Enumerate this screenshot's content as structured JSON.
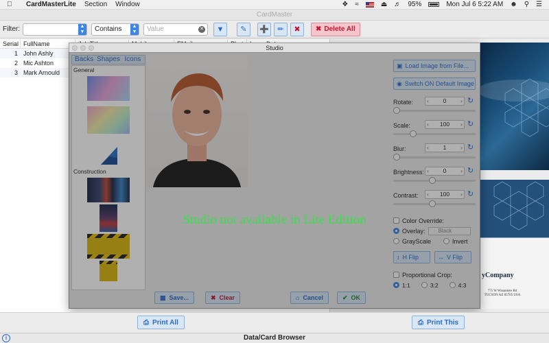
{
  "menubar": {
    "app_name": "CardMasterLite",
    "items": [
      "Section",
      "Window"
    ],
    "battery": "95%",
    "datetime": "Mon Jul 6  5:22 AM"
  },
  "main_window": {
    "title": "CardMaster"
  },
  "toolbar": {
    "filter_label": "Filter:",
    "filter_value": "",
    "operator": "Contains",
    "value_placeholder": "Value",
    "delete_all_label": "Delete All"
  },
  "table": {
    "headers": [
      "Serial",
      "FullName",
      "Job Title",
      "Mobile",
      "EMail",
      "Photo",
      "Issue Date"
    ],
    "rows": [
      {
        "serial": "1",
        "name": "John Ashly"
      },
      {
        "serial": "2",
        "name": "Mic Ashton"
      },
      {
        "serial": "3",
        "name": "Mark Arnould"
      }
    ]
  },
  "cards": {
    "company": "yCompany",
    "address": "775 W Wanamere Rd TUCSON AZ 85705 USA"
  },
  "bottom": {
    "print_all_label": "Print All",
    "print_this_label": "Print This",
    "status": "Data/Card Browser"
  },
  "studio": {
    "title": "Studio",
    "tabs": [
      "Backs",
      "Shapes",
      "Icons"
    ],
    "sections": [
      "General",
      "Construction"
    ],
    "load_image_label": "Load Image from File...",
    "switch_default_label": "Switch ON Default Image",
    "controls": [
      {
        "label": "Rotate:",
        "value": "0",
        "level": 0.0
      },
      {
        "label": "Scale:",
        "value": "100",
        "level": 0.2
      },
      {
        "label": "Blur:",
        "value": "1",
        "level": 0.0
      },
      {
        "label": "Brightness:",
        "value": "0",
        "level": 0.5
      },
      {
        "label": "Contrast:",
        "value": "100",
        "level": 0.5
      }
    ],
    "color_override_label": "Color Override:",
    "overlay_label": "Overlay:",
    "overlay_color": "Black",
    "grayscale_label": "GrayScale",
    "invert_label": "Invert",
    "hflip_label": "H Flip",
    "vflip_label": "V Flip",
    "proportional_label": "Proportional Crop:",
    "ratios": [
      "1:1",
      "3:2",
      "4:3"
    ],
    "save_label": "Save...",
    "clear_label": "Clear",
    "cancel_label": "Cancel",
    "ok_label": "OK",
    "lite_message": "Studio not available in Lite Edition"
  },
  "colors": {
    "accent": "#3d86e6",
    "lite_text": "#39e04b",
    "delete": "#c0182e"
  }
}
